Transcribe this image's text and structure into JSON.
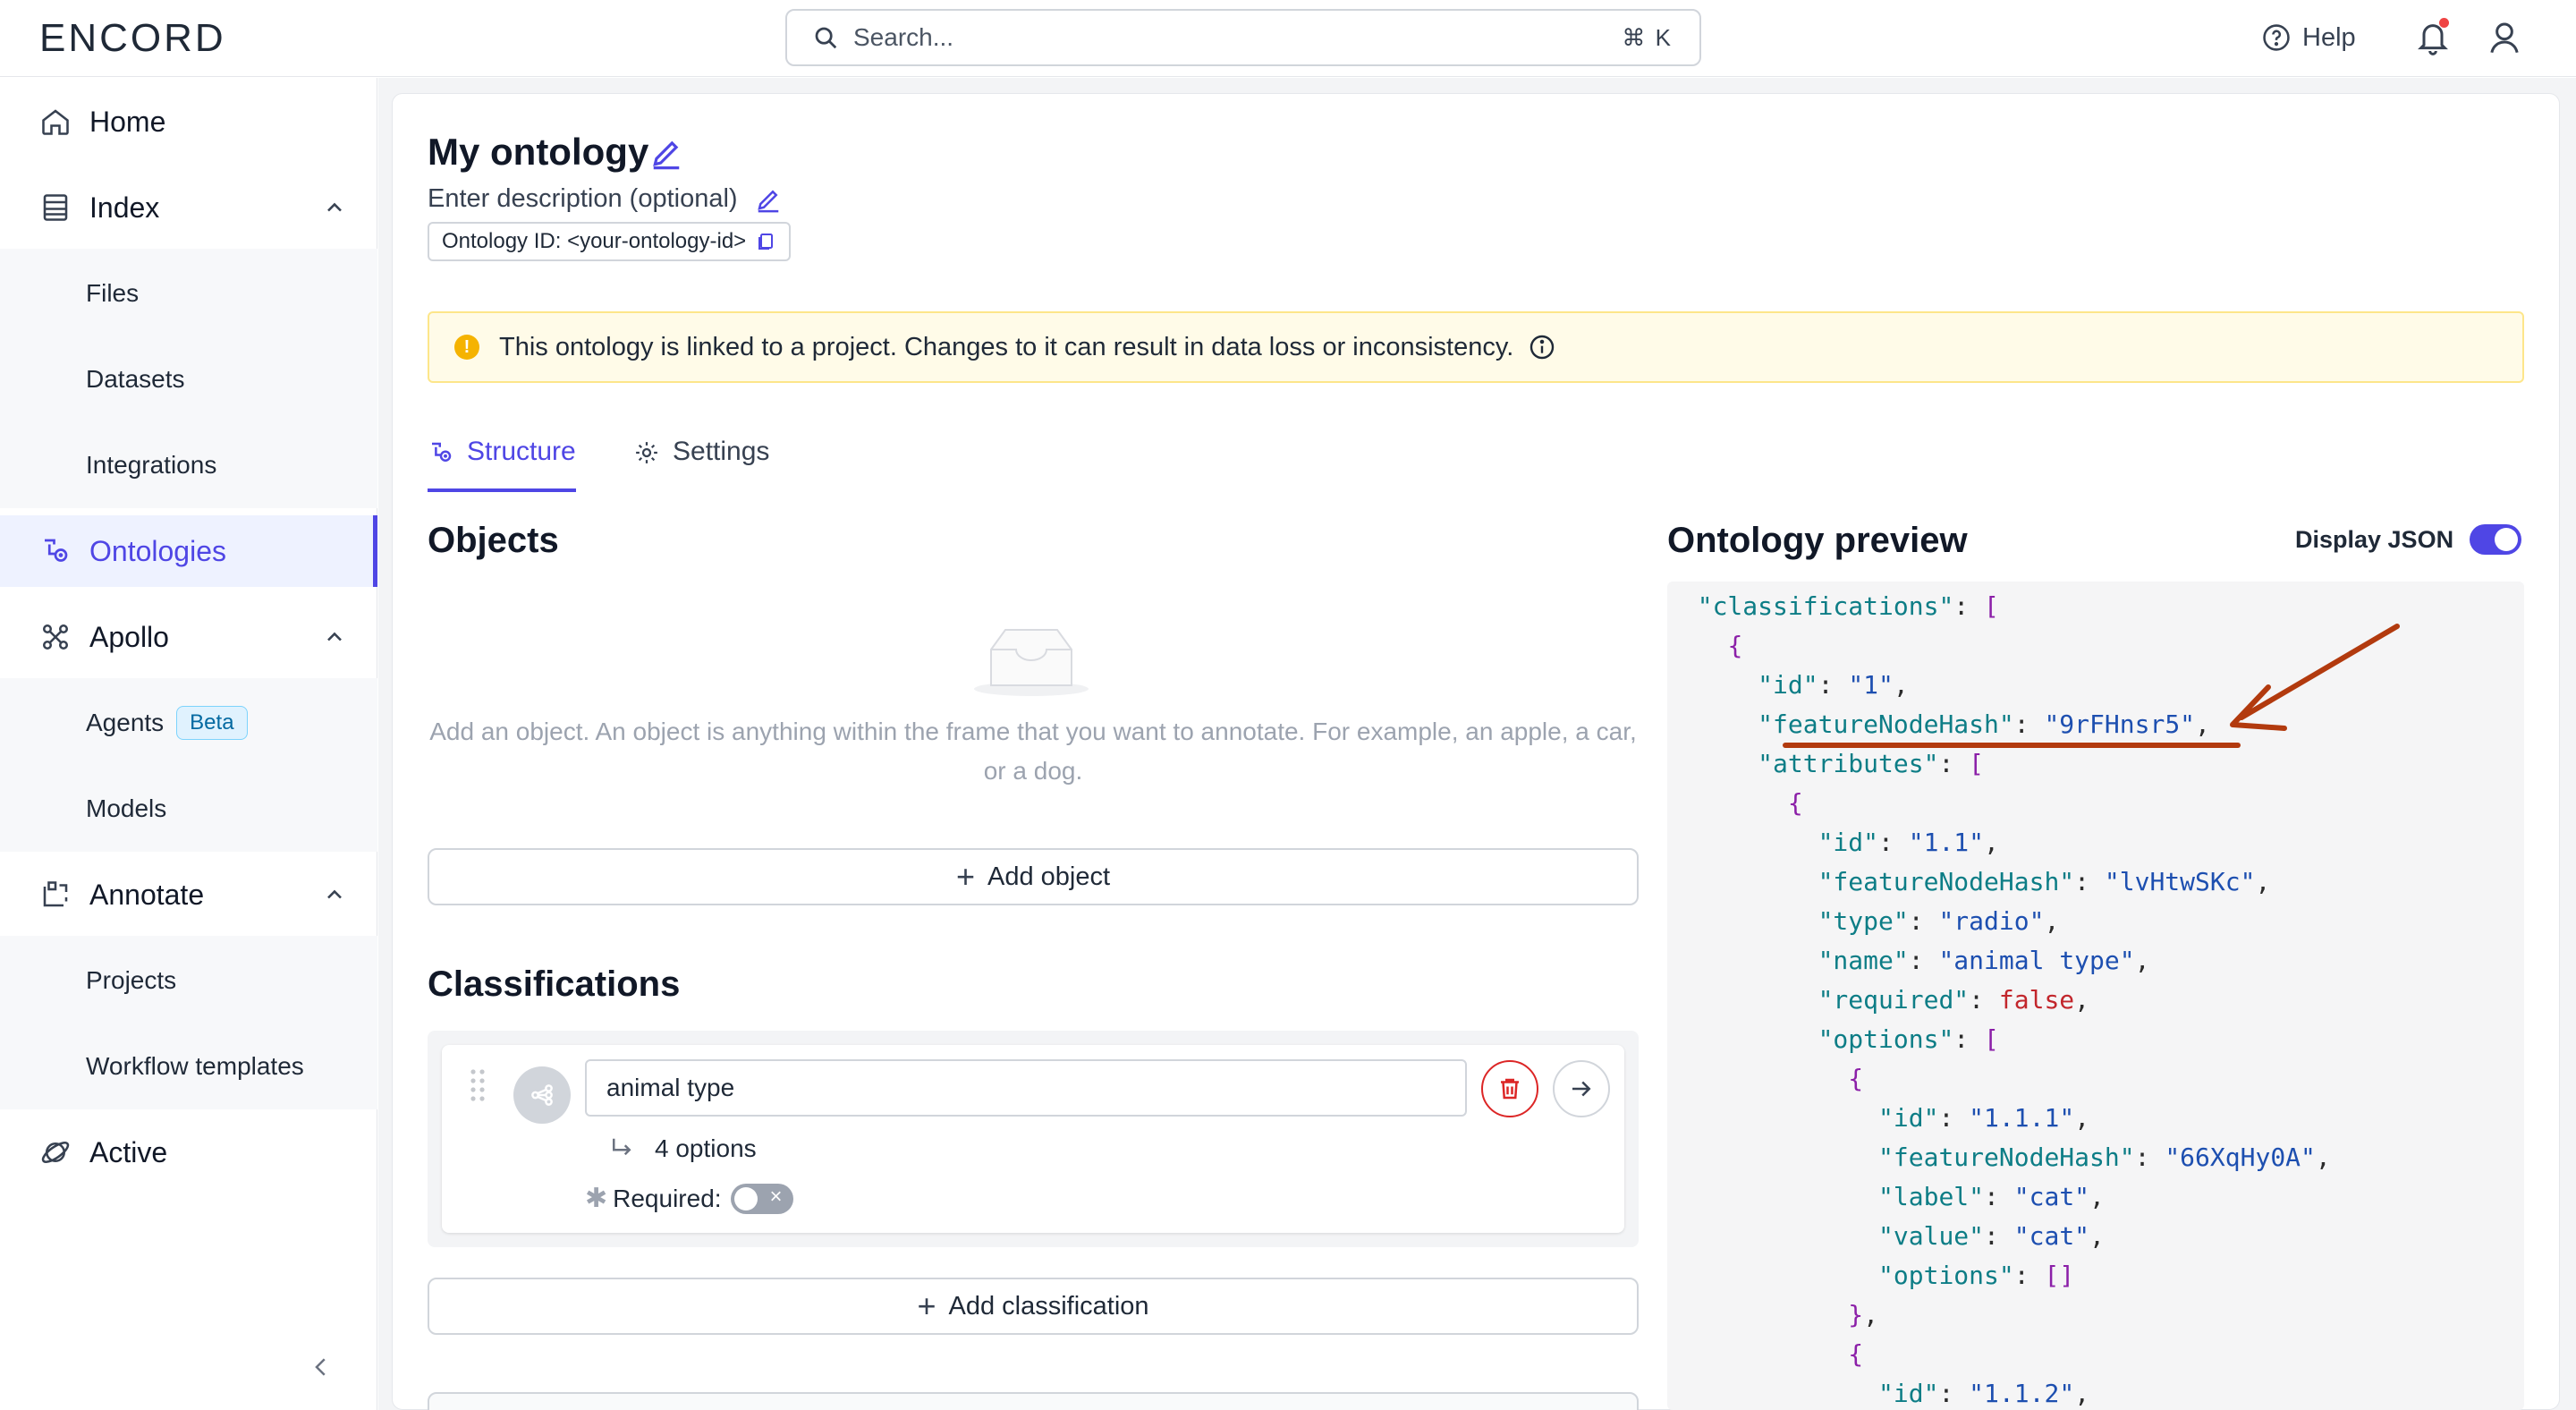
{
  "header": {
    "logo": "ENCORD",
    "search_placeholder": "Search...",
    "search_shortcut": "⌘ K",
    "help_label": "Help"
  },
  "sidebar": {
    "home": "Home",
    "index": "Index",
    "index_items": [
      "Files",
      "Datasets",
      "Integrations"
    ],
    "ontologies": "Ontologies",
    "apollo": "Apollo",
    "apollo_items": [
      "Agents",
      "Models"
    ],
    "beta": "Beta",
    "annotate": "Annotate",
    "annotate_items": [
      "Projects",
      "Workflow templates"
    ],
    "active": "Active"
  },
  "page": {
    "title": "My ontology",
    "description": "Enter description (optional)",
    "ontology_id": "Ontology ID: <your-ontology-id>",
    "alert": "This ontology is linked to a project. Changes to it can result in data loss or inconsistency.",
    "tabs": [
      "Structure",
      "Settings"
    ]
  },
  "objects": {
    "heading": "Objects",
    "empty_text": "Add an object. An object is anything within the frame that you want to annotate. For example, an apple, a car, or a dog.",
    "add_button": "Add object"
  },
  "classifications": {
    "heading": "Classifications",
    "item_name": "animal type",
    "options_count": "4 options",
    "required_label": "Required:",
    "add_button": "Add classification"
  },
  "preview": {
    "heading": "Ontology preview",
    "display_json_label": "Display JSON",
    "display_json_on": true,
    "json_lines": [
      [
        [
          "  ",
          "c"
        ],
        [
          "\"classifications\"",
          "k"
        ],
        [
          ": ",
          "c"
        ],
        [
          "[",
          "p"
        ]
      ],
      [
        [
          "    ",
          "c"
        ],
        [
          "{",
          "p"
        ]
      ],
      [
        [
          "      ",
          "c"
        ],
        [
          "\"id\"",
          "k"
        ],
        [
          ": ",
          "c"
        ],
        [
          "\"1\"",
          "s"
        ],
        [
          ",",
          "c"
        ]
      ],
      [
        [
          "      ",
          "c"
        ],
        [
          "\"featureNodeHash\"",
          "k"
        ],
        [
          ": ",
          "c"
        ],
        [
          "\"9rFHnsr5\"",
          "s"
        ],
        [
          ",",
          "c"
        ]
      ],
      [
        [
          "      ",
          "c"
        ],
        [
          "\"attributes\"",
          "k"
        ],
        [
          ": ",
          "c"
        ],
        [
          "[",
          "p"
        ]
      ],
      [
        [
          "        ",
          "c"
        ],
        [
          "{",
          "p"
        ]
      ],
      [
        [
          "          ",
          "c"
        ],
        [
          "\"id\"",
          "k"
        ],
        [
          ": ",
          "c"
        ],
        [
          "\"1.1\"",
          "s"
        ],
        [
          ",",
          "c"
        ]
      ],
      [
        [
          "          ",
          "c"
        ],
        [
          "\"featureNodeHash\"",
          "k"
        ],
        [
          ": ",
          "c"
        ],
        [
          "\"lvHtwSKc\"",
          "s"
        ],
        [
          ",",
          "c"
        ]
      ],
      [
        [
          "          ",
          "c"
        ],
        [
          "\"type\"",
          "k"
        ],
        [
          ": ",
          "c"
        ],
        [
          "\"radio\"",
          "s"
        ],
        [
          ",",
          "c"
        ]
      ],
      [
        [
          "          ",
          "c"
        ],
        [
          "\"name\"",
          "k"
        ],
        [
          ": ",
          "c"
        ],
        [
          "\"animal type\"",
          "s"
        ],
        [
          ",",
          "c"
        ]
      ],
      [
        [
          "          ",
          "c"
        ],
        [
          "\"required\"",
          "k"
        ],
        [
          ": ",
          "c"
        ],
        [
          "false",
          "b"
        ],
        [
          ",",
          "c"
        ]
      ],
      [
        [
          "          ",
          "c"
        ],
        [
          "\"options\"",
          "k"
        ],
        [
          ": ",
          "c"
        ],
        [
          "[",
          "p"
        ]
      ],
      [
        [
          "            ",
          "c"
        ],
        [
          "{",
          "p"
        ]
      ],
      [
        [
          "              ",
          "c"
        ],
        [
          "\"id\"",
          "k"
        ],
        [
          ": ",
          "c"
        ],
        [
          "\"1.1.1\"",
          "s"
        ],
        [
          ",",
          "c"
        ]
      ],
      [
        [
          "              ",
          "c"
        ],
        [
          "\"featureNodeHash\"",
          "k"
        ],
        [
          ": ",
          "c"
        ],
        [
          "\"66XqHy0A\"",
          "s"
        ],
        [
          ",",
          "c"
        ]
      ],
      [
        [
          "              ",
          "c"
        ],
        [
          "\"label\"",
          "k"
        ],
        [
          ": ",
          "c"
        ],
        [
          "\"cat\"",
          "s"
        ],
        [
          ",",
          "c"
        ]
      ],
      [
        [
          "              ",
          "c"
        ],
        [
          "\"value\"",
          "k"
        ],
        [
          ": ",
          "c"
        ],
        [
          "\"cat\"",
          "s"
        ],
        [
          ",",
          "c"
        ]
      ],
      [
        [
          "              ",
          "c"
        ],
        [
          "\"options\"",
          "k"
        ],
        [
          ": ",
          "c"
        ],
        [
          "[]",
          "p"
        ]
      ],
      [
        [
          "            ",
          "c"
        ],
        [
          "}",
          "p"
        ],
        [
          ",",
          "c"
        ]
      ],
      [
        [
          "            ",
          "c"
        ],
        [
          "{",
          "p"
        ]
      ],
      [
        [
          "              ",
          "c"
        ],
        [
          "\"id\"",
          "k"
        ],
        [
          ": ",
          "c"
        ],
        [
          "\"1.1.2\"",
          "s"
        ],
        [
          ",",
          "c"
        ]
      ]
    ]
  },
  "colors": {
    "accent": "#4f46e5",
    "annotation_arrow": "#b23a0e",
    "alert_bg": "#fffbe8"
  }
}
